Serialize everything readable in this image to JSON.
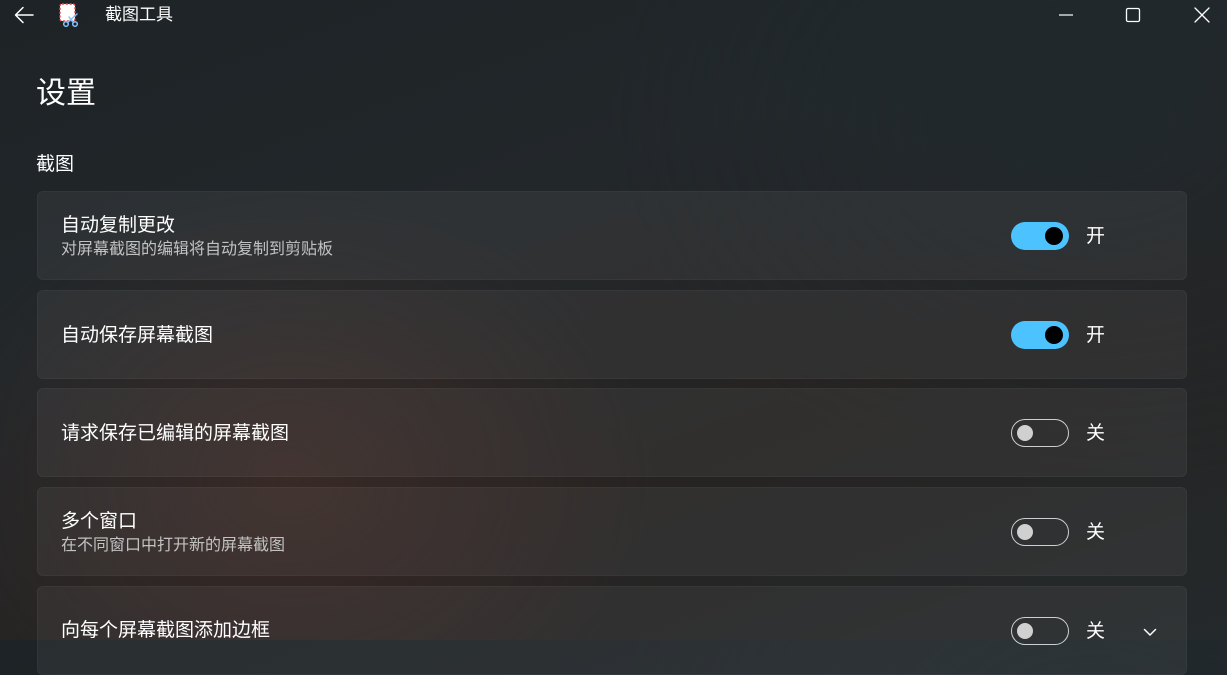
{
  "app": {
    "title": "截图工具"
  },
  "page": {
    "title": "设置",
    "section_title": "截图"
  },
  "settings": [
    {
      "title": "自动复制更改",
      "description": "对屏幕截图的编辑将自动复制到剪贴板",
      "state": "on",
      "state_label": "开"
    },
    {
      "title": "自动保存屏幕截图",
      "description": "",
      "state": "on",
      "state_label": "开"
    },
    {
      "title": "请求保存已编辑的屏幕截图",
      "description": "",
      "state": "off",
      "state_label": "关"
    },
    {
      "title": "多个窗口",
      "description": "在不同窗口中打开新的屏幕截图",
      "state": "off",
      "state_label": "关"
    },
    {
      "title": "向每个屏幕截图添加边框",
      "description": "",
      "state": "off",
      "state_label": "关",
      "expandable": true
    }
  ],
  "colors": {
    "accent": "#4cc2ff",
    "toggle_off_border": "#cfcfcf",
    "text_primary": "#ffffff",
    "text_secondary": "#c2c2c2"
  },
  "icons": {
    "back": "arrow-left-icon",
    "app": "snipping-tool-icon",
    "minimize": "minimize-icon",
    "maximize": "maximize-icon",
    "close": "close-icon",
    "expand": "chevron-down-icon"
  }
}
